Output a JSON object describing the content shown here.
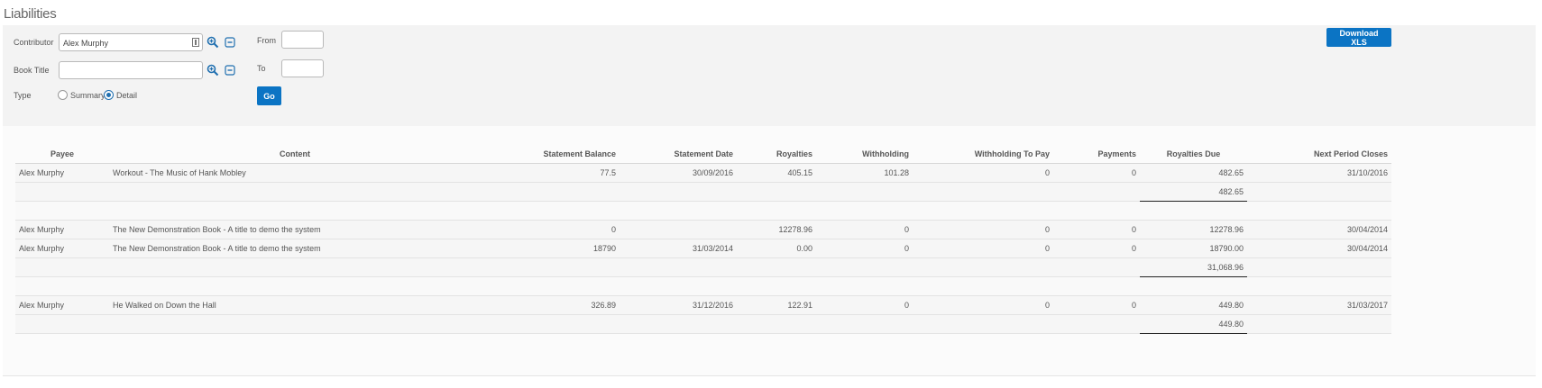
{
  "page": {
    "title": "Liabilities"
  },
  "filters": {
    "contributor_label": "Contributor",
    "contributor_value": "Alex Murphy",
    "book_title_label": "Book Title",
    "book_title_value": "",
    "type_label": "Type",
    "type_options": [
      "Summary",
      "Detail"
    ],
    "type_selected": "Detail",
    "from_label": "From",
    "from_value": "",
    "to_label": "To",
    "to_value": "",
    "go_label": "Go",
    "download_label": "Download XLS"
  },
  "table": {
    "columns": [
      "Payee",
      "Content",
      "Statement Balance",
      "Statement Date",
      "Royalties",
      "Withholding",
      "Withholding To Pay",
      "Payments",
      "Royalties Due",
      "Next Period Closes"
    ],
    "groups": [
      {
        "rows": [
          [
            "Alex Murphy",
            "Workout - The Music of Hank Mobley",
            "77.5",
            "30/09/2016",
            "405.15",
            "101.28",
            "0",
            "0",
            "482.65",
            "31/10/2016"
          ]
        ],
        "total": "482.65"
      },
      {
        "rows": [
          [
            "Alex Murphy",
            "The New Demonstration Book - A title to demo the system",
            "0",
            "",
            "12278.96",
            "0",
            "0",
            "0",
            "12278.96",
            "30/04/2014"
          ],
          [
            "Alex Murphy",
            "The New Demonstration Book - A title to demo the system",
            "18790",
            "31/03/2014",
            "0.00",
            "0",
            "0",
            "0",
            "18790.00",
            "30/04/2014"
          ]
        ],
        "total": "31,068.96"
      },
      {
        "rows": [
          [
            "Alex Murphy",
            "He Walked on Down the Hall",
            "326.89",
            "31/12/2016",
            "122.91",
            "0",
            "0",
            "0",
            "449.80",
            "31/03/2017"
          ]
        ],
        "total": "449.80"
      }
    ]
  },
  "colors": {
    "primary_button": "#0b74c4",
    "panel_bg": "#f3f3f3",
    "total_rule": "#222222"
  },
  "icons": [
    "search-plus-icon",
    "minus-square-icon",
    "lookup-picker-icon"
  ]
}
